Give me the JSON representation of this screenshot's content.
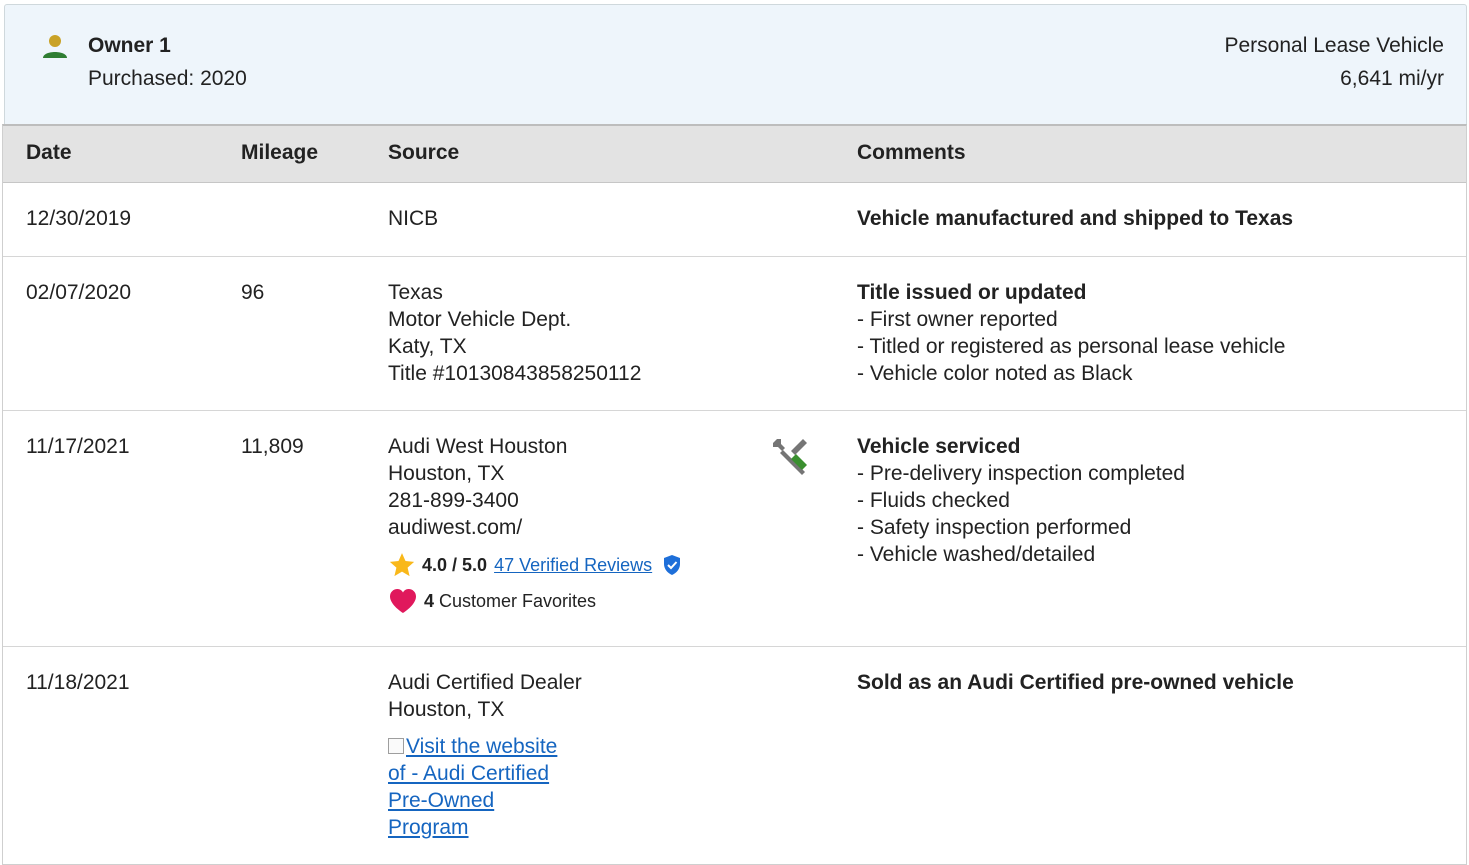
{
  "owner": {
    "title": "Owner 1",
    "purchased": "Purchased: 2020",
    "type": "Personal Lease Vehicle",
    "miles_per_year": "6,641 mi/yr",
    "icon": "person-icon",
    "icon_color": "#2e7d32",
    "icon_head_color": "#c9a227"
  },
  "table": {
    "headers": {
      "date": "Date",
      "mileage": "Mileage",
      "source": "Source",
      "comments": "Comments"
    },
    "rows": [
      {
        "date": "12/30/2019",
        "mileage": "",
        "source": [
          "NICB"
        ],
        "comment_title": "Vehicle manufactured and shipped to Texas",
        "comment_items": []
      },
      {
        "date": "02/07/2020",
        "mileage": "96",
        "source": [
          "Texas",
          "Motor Vehicle Dept.",
          "Katy, TX",
          "Title #10130843858250112"
        ],
        "comment_title": "Title issued or updated",
        "comment_items": [
          "- First owner reported",
          "- Titled or registered as personal lease vehicle",
          "- Vehicle color noted as Black"
        ]
      },
      {
        "date": "11/17/2021",
        "mileage": "11,809",
        "source": [
          "Audi West Houston",
          "Houston, TX",
          "281-899-3400",
          "audiwest.com/"
        ],
        "rating": "4.0 / 5.0",
        "reviews_link": "47 Verified Reviews",
        "favorites_count": "4",
        "favorites_label": "Customer Favorites",
        "service_icon": "tools-icon",
        "comment_title": "Vehicle serviced",
        "comment_items": [
          "- Pre-delivery inspection completed",
          "- Fluids checked",
          "- Safety inspection performed",
          "- Vehicle washed/detailed"
        ]
      },
      {
        "date": "11/18/2021",
        "mileage": "",
        "source": [
          "Audi Certified Dealer",
          "Houston, TX"
        ],
        "cert_link": "Visit the website of - Audi Certified Pre-Owned Program",
        "comment_title": "Sold as an Audi Certified pre-owned vehicle",
        "comment_items": []
      }
    ]
  },
  "colors": {
    "link": "#1565c0",
    "star": "#f9b81a",
    "heart": "#e0185c",
    "shield": "#1e6fd9",
    "header_bg": "#eef5fb",
    "table_header_bg": "#e3e3e3"
  }
}
